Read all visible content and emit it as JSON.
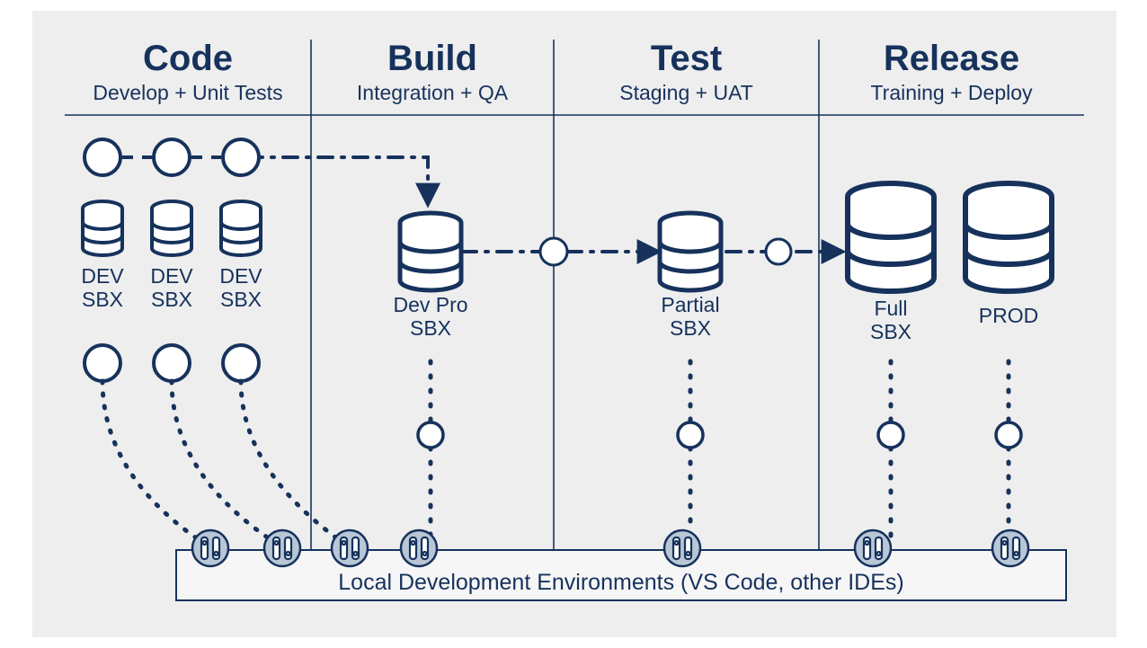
{
  "stages": {
    "code": {
      "title": "Code",
      "subtitle": "Develop + Unit Tests"
    },
    "build": {
      "title": "Build",
      "subtitle": "Integration + QA"
    },
    "test": {
      "title": "Test",
      "subtitle": "Staging + UAT"
    },
    "release": {
      "title": "Release",
      "subtitle": "Training + Deploy"
    }
  },
  "environments": {
    "dev1": {
      "line1": "DEV",
      "line2": "SBX"
    },
    "dev2": {
      "line1": "DEV",
      "line2": "SBX"
    },
    "dev3": {
      "line1": "DEV",
      "line2": "SBX"
    },
    "devpro": {
      "line1": "Dev Pro",
      "line2": "SBX"
    },
    "partial": {
      "line1": "Partial",
      "line2": "SBX"
    },
    "full": {
      "line1": "Full",
      "line2": "SBX"
    },
    "prod": {
      "line1": "PROD"
    }
  },
  "footer": "Local Development Environments (VS Code, other IDEs)"
}
